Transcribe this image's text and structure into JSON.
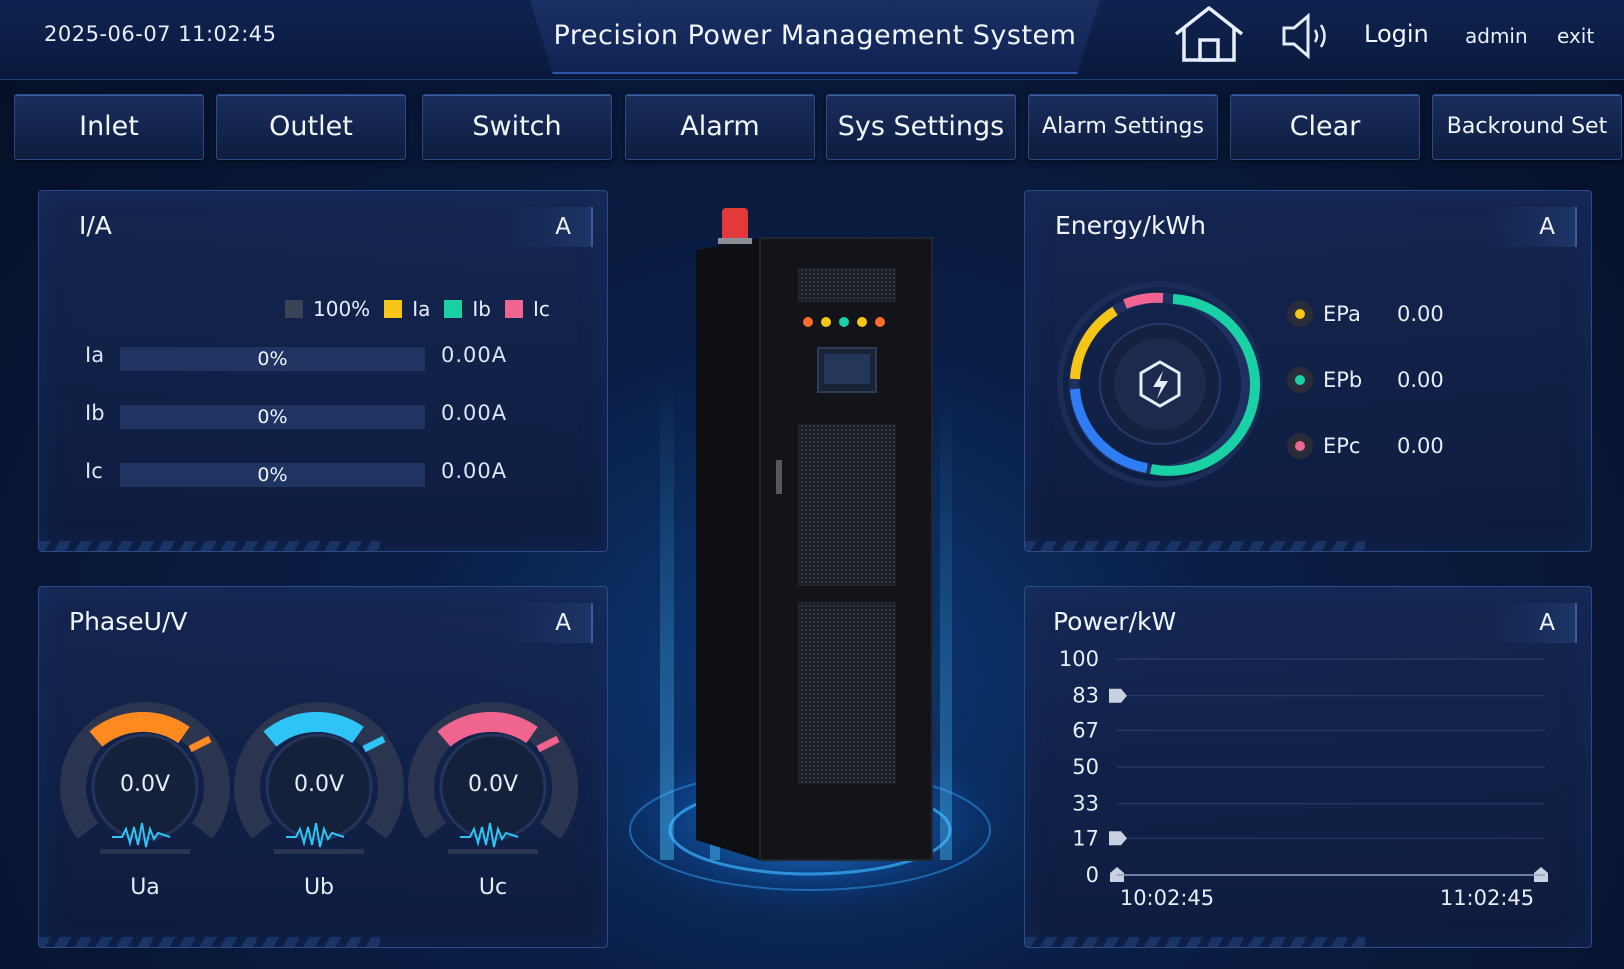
{
  "header": {
    "datetime": "2025-06-07 11:02:45",
    "title": "Precision Power Management System",
    "login": "Login",
    "user": "admin",
    "exit": "exit"
  },
  "nav": [
    {
      "label": "Inlet"
    },
    {
      "label": "Outlet"
    },
    {
      "label": "Switch"
    },
    {
      "label": "Alarm"
    },
    {
      "label": "Sys Settings"
    },
    {
      "label": "Alarm Settings"
    },
    {
      "label": "Clear"
    },
    {
      "label": "Backround Set"
    }
  ],
  "current": {
    "title": "I/A",
    "tag": "A",
    "legend": [
      {
        "label": "100%",
        "color": "#3a4256"
      },
      {
        "label": "Ia",
        "color": "#f5c518"
      },
      {
        "label": "Ib",
        "color": "#19d1a5"
      },
      {
        "label": "Ic",
        "color": "#f0658f"
      }
    ],
    "rows": [
      {
        "label": "Ia",
        "percent": "0%",
        "value": "0.00A",
        "fraction": 0
      },
      {
        "label": "Ib",
        "percent": "0%",
        "value": "0.00A",
        "fraction": 0
      },
      {
        "label": "Ic",
        "percent": "0%",
        "value": "0.00A",
        "fraction": 0
      }
    ]
  },
  "voltage": {
    "title": "PhaseU/V",
    "tag": "A",
    "gauges": [
      {
        "name": "Ua",
        "value": "0.0V",
        "color": "#ff8a1f"
      },
      {
        "name": "Ub",
        "value": "0.0V",
        "color": "#2ec4f5"
      },
      {
        "name": "Uc",
        "value": "0.0V",
        "color": "#f0658f"
      }
    ]
  },
  "energy": {
    "title": "Energy/kWh",
    "tag": "A",
    "items": [
      {
        "label": "EPa",
        "value": "0.00",
        "color": "#f5c518"
      },
      {
        "label": "EPb",
        "value": "0.00",
        "color": "#19d1a5"
      },
      {
        "label": "EPc",
        "value": "0.00",
        "color": "#f0658f"
      }
    ]
  },
  "power": {
    "title": "Power/kW",
    "tag": "A"
  },
  "chart_data": {
    "type": "line",
    "title": "Power/kW",
    "x": [
      "10:02:45",
      "11:02:45"
    ],
    "ylim": [
      0,
      100
    ],
    "yticks": [
      "100",
      "83",
      "67",
      "50",
      "33",
      "17",
      "0"
    ],
    "series": [
      {
        "values": [
          0,
          0
        ]
      }
    ],
    "grid": true
  }
}
